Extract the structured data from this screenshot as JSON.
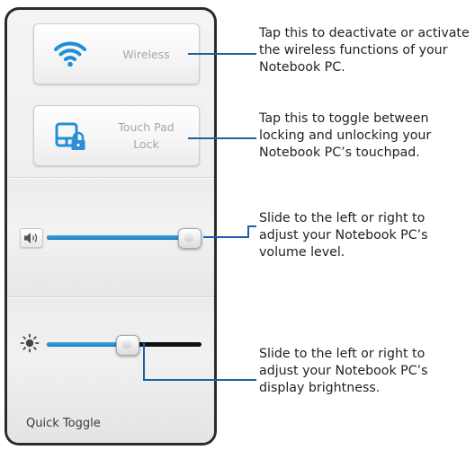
{
  "panel": {
    "wireless_tile": {
      "label": "Wireless",
      "icon": "wifi-icon"
    },
    "touchpad_tile": {
      "label_line1": "Touch Pad",
      "label_line2": "Lock",
      "icon": "touchpad-lock-icon"
    },
    "volume_slider": {
      "icon": "speaker-icon",
      "level": 0.92
    },
    "brightness_slider": {
      "icon": "sun-icon",
      "level": 0.52
    },
    "footer_label": "Quick Toggle"
  },
  "callouts": {
    "wireless": {
      "line1": "Tap this to deactivate or activate",
      "line2": "the wireless functions of your",
      "line3": "Notebook PC."
    },
    "touchpad": {
      "line1": "Tap this to toggle between",
      "line2": "locking and unlocking your",
      "line3": "Notebook PC’s touchpad."
    },
    "volume": {
      "line1": "Slide to the left or right to",
      "line2": "adjust your Notebook PC’s",
      "line3": "volume level."
    },
    "brightness": {
      "line1": "Slide to the left or right to",
      "line2": "adjust your Notebook PC’s",
      "line3": "display brightness."
    }
  },
  "colors": {
    "accent_blue": "#1a7fc4",
    "leader_line": "#1f5fa6",
    "panel_frame": "#2b2b2b",
    "lock_blue": "#2a8fd6"
  }
}
